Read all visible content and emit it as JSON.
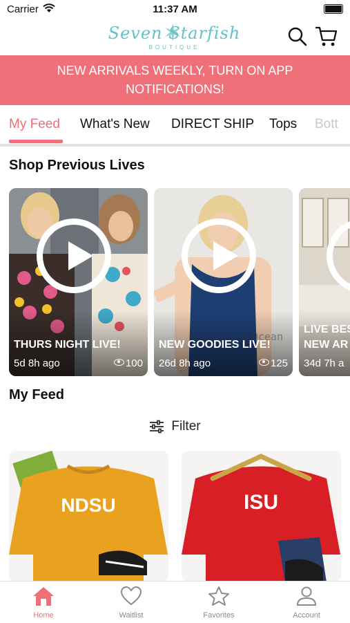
{
  "status_bar": {
    "carrier": "Carrier",
    "time": "11:37 AM"
  },
  "header": {
    "logo_script": "Seven Starfish",
    "logo_sub": "BOUTIQUE",
    "icons": [
      "search-icon",
      "cart-icon"
    ]
  },
  "banner": {
    "text": "NEW ARRIVALS WEEKLY, TURN ON APP NOTIFICATIONS!"
  },
  "tabs": [
    {
      "label": "My Feed",
      "active": true
    },
    {
      "label": "What's New"
    },
    {
      "label": "DIRECT SHIP"
    },
    {
      "label": "Tops"
    },
    {
      "label": "Bott"
    }
  ],
  "previous_lives": {
    "title": "Shop Previous Lives",
    "cards": [
      {
        "title": "THURS NIGHT LIVE!",
        "ago": "5d 8h ago",
        "views": "100"
      },
      {
        "title": "NEW GOODIES LIVE!",
        "ago": "26d 8h ago",
        "views": "125",
        "watermark": "Ocean"
      },
      {
        "title": "LIVE BES",
        "subtitle": "NEW AR",
        "ago": "34d 7h a"
      }
    ]
  },
  "feed": {
    "title": "My Feed",
    "filter_label": "Filter",
    "products": [
      {
        "print": "NDSU",
        "color": "#e9a21f"
      },
      {
        "print": "ISU",
        "color": "#d81f26"
      }
    ]
  },
  "bottom_nav": [
    {
      "label": "Home",
      "icon": "home-icon",
      "active": true
    },
    {
      "label": "Waitlist",
      "icon": "heart-icon"
    },
    {
      "label": "Favorites",
      "icon": "star-icon"
    },
    {
      "label": "Account",
      "icon": "account-icon"
    }
  ],
  "colors": {
    "accent": "#ef6f78",
    "banner": "#f0707a",
    "logo": "#63c2c4"
  }
}
